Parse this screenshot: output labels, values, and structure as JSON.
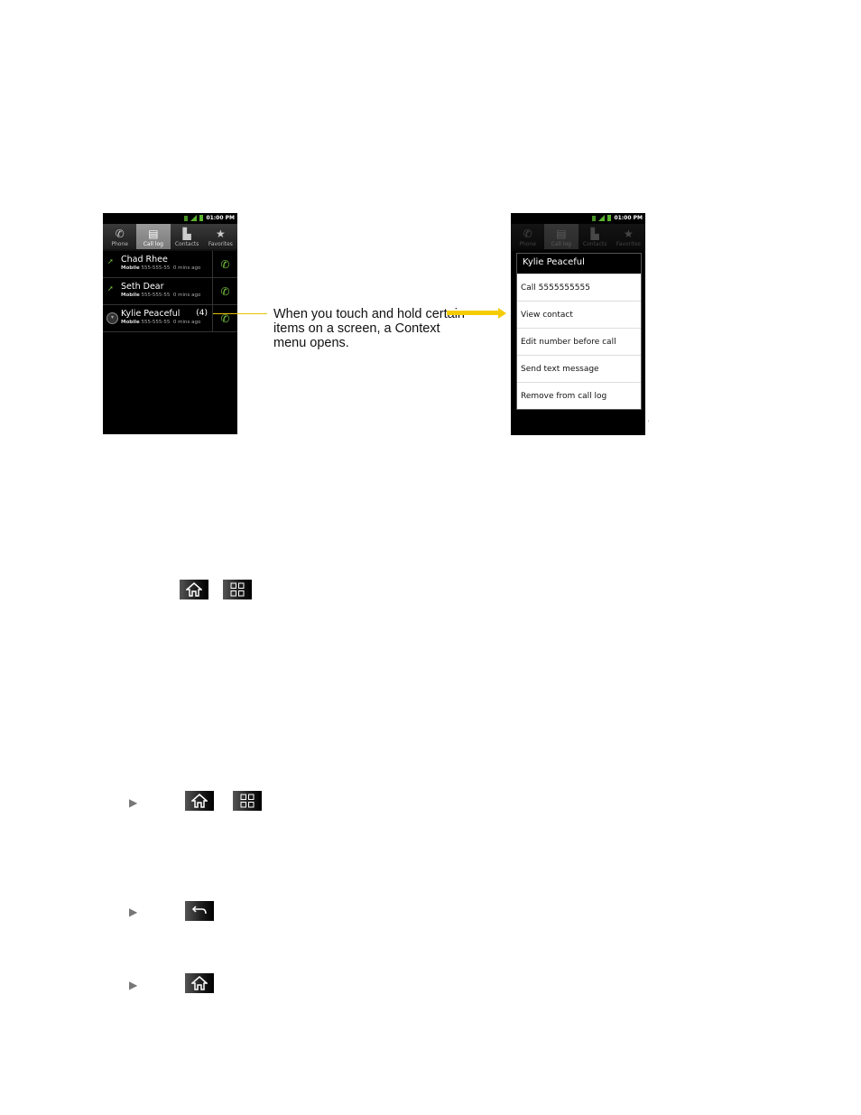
{
  "status_bar": {
    "time": "01:00 PM"
  },
  "tabs": [
    {
      "label": "Phone",
      "icon": "phone-icon"
    },
    {
      "label": "Call log",
      "icon": "call-log-icon",
      "active": true
    },
    {
      "label": "Contacts",
      "icon": "contacts-icon"
    },
    {
      "label": "Favorites",
      "icon": "star-icon"
    }
  ],
  "call_log": [
    {
      "name": "Chad Rhee",
      "type": "Mobile",
      "number": "555-555-55",
      "time": "0 mins ago",
      "count": ""
    },
    {
      "name": "Seth Dear",
      "type": "Mobile",
      "number": "555-555-55",
      "time": "0 mins ago",
      "count": ""
    },
    {
      "name": "Kylie Peaceful",
      "type": "Mobile",
      "number": "555-555-55",
      "time": "0 mins ago",
      "count": "(4)"
    }
  ],
  "callout": {
    "text": "When you touch and hold certain items on a screen, a Context menu opens."
  },
  "context_menu": {
    "title": "Kylie Peaceful",
    "items": [
      "Call 5555555555",
      "View contact",
      "Edit number before call",
      "Send text message",
      "Remove from call log"
    ]
  },
  "bullets": {
    "glyph": "▶"
  },
  "colors": {
    "accent_green": "#7ac943",
    "callout_yellow": "#f5cc00"
  }
}
